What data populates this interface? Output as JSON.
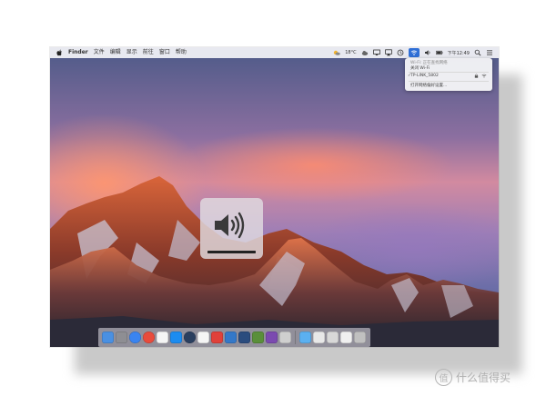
{
  "menubar": {
    "app_name": "Finder",
    "items": [
      "文件",
      "编辑",
      "显示",
      "前往",
      "窗口",
      "帮助"
    ],
    "status": {
      "temperature": "18°C",
      "clock": "下午12:49"
    }
  },
  "wifi_menu": {
    "status_line": "Wi-Fi: 正在查找网络",
    "toggle_label": "关闭 Wi-Fi",
    "network_name": "TP-LINK_5802",
    "preferences_label": "打开网络偏好设置..."
  },
  "volume_hud": {
    "level": 1.0
  },
  "dock": {
    "icons": [
      "finder-icon",
      "launchpad-icon",
      "safari-icon",
      "chrome-icon",
      "calendar-icon",
      "app-store-icon",
      "steam-icon",
      "music-icon",
      "app-red-icon",
      "app-blue-icon",
      "photoshop-icon",
      "minecraft-icon",
      "app-purple-icon",
      "app-gray-icon",
      "downloads-folder-icon",
      "documents-icon",
      "finder-window-icon",
      "image-icon",
      "trash-icon"
    ],
    "colors": [
      "#4a90e2",
      "#8e8e93",
      "#3a84f0",
      "#e94b3c",
      "#f5f5f5",
      "#1c8cf0",
      "#2a3f5f",
      "#f5f5f5",
      "#e0413a",
      "#3478c8",
      "#2b4c7e",
      "#5a8f3a",
      "#7b4ab0",
      "#cfcfcf",
      "#5bb0f0",
      "#e8e8e8",
      "#d8d8d8",
      "#f0f0f0",
      "#c0c0c0"
    ]
  },
  "watermark": {
    "logo_char": "值",
    "text": "什么值得买"
  }
}
